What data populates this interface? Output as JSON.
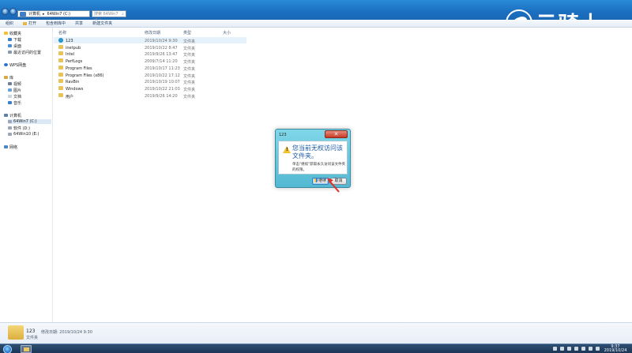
{
  "titlebar": {
    "address_parts": [
      "计算机",
      "64Win7 (C:)"
    ],
    "search_placeholder": "搜索 64Win7 (C:)"
  },
  "logo": {
    "text": "云骑士"
  },
  "toolbar": {
    "items": [
      "组织",
      "打开",
      "包含到库中",
      "共享",
      "新建文件夹"
    ]
  },
  "sidebar": {
    "favorites_header": "收藏夹",
    "favorites": [
      "下载",
      "桌面",
      "最近访问的位置"
    ],
    "wps": "WPS网盘",
    "libraries_header": "库",
    "libraries": [
      "视频",
      "图片",
      "文档",
      "音乐"
    ],
    "computer_header": "计算机",
    "drives": [
      "64Win7 (C:)",
      "软件 (D:)",
      "64Win10 (E:)"
    ],
    "network": "网络"
  },
  "columns": {
    "name": "名称",
    "date": "修改日期",
    "type": "类型",
    "size": "大小"
  },
  "files": [
    {
      "name": "123",
      "date": "2019/10/24 9:30",
      "type": "文件夹",
      "special": true,
      "selected": true
    },
    {
      "name": "inetpub",
      "date": "2019/10/22 8:47",
      "type": "文件夹"
    },
    {
      "name": "Intel",
      "date": "2019/9/26 13:47",
      "type": "文件夹"
    },
    {
      "name": "PerfLogs",
      "date": "2009/7/14 11:20",
      "type": "文件夹"
    },
    {
      "name": "Program Files",
      "date": "2019/10/17 11:23",
      "type": "文件夹"
    },
    {
      "name": "Program Files (x86)",
      "date": "2019/10/22 17:12",
      "type": "文件夹"
    },
    {
      "name": "RavBin",
      "date": "2019/10/19 10:07",
      "type": "文件夹"
    },
    {
      "name": "Windows",
      "date": "2019/10/22 21:03",
      "type": "文件夹"
    },
    {
      "name": "用户",
      "date": "2019/9/26 14:20",
      "type": "文件夹"
    }
  ],
  "details": {
    "name": "123",
    "modified": "修改日期: 2019/10/24 9:30",
    "type": "文件夹"
  },
  "dialog": {
    "title": "123",
    "close": "✕",
    "heading": "您当前无权访问该文件夹。",
    "message": "单击\"继续\"获取永久访问该文件夹的权限。",
    "continue_label": "继续",
    "cancel_label": "取消"
  },
  "taskbar": {
    "time": "9:37",
    "date": "2019/10/24"
  },
  "colors": {
    "accent": "#1b6fc0",
    "dialog": "#53b9d2",
    "close": "#c63a25",
    "arrow": "#d9342b"
  }
}
